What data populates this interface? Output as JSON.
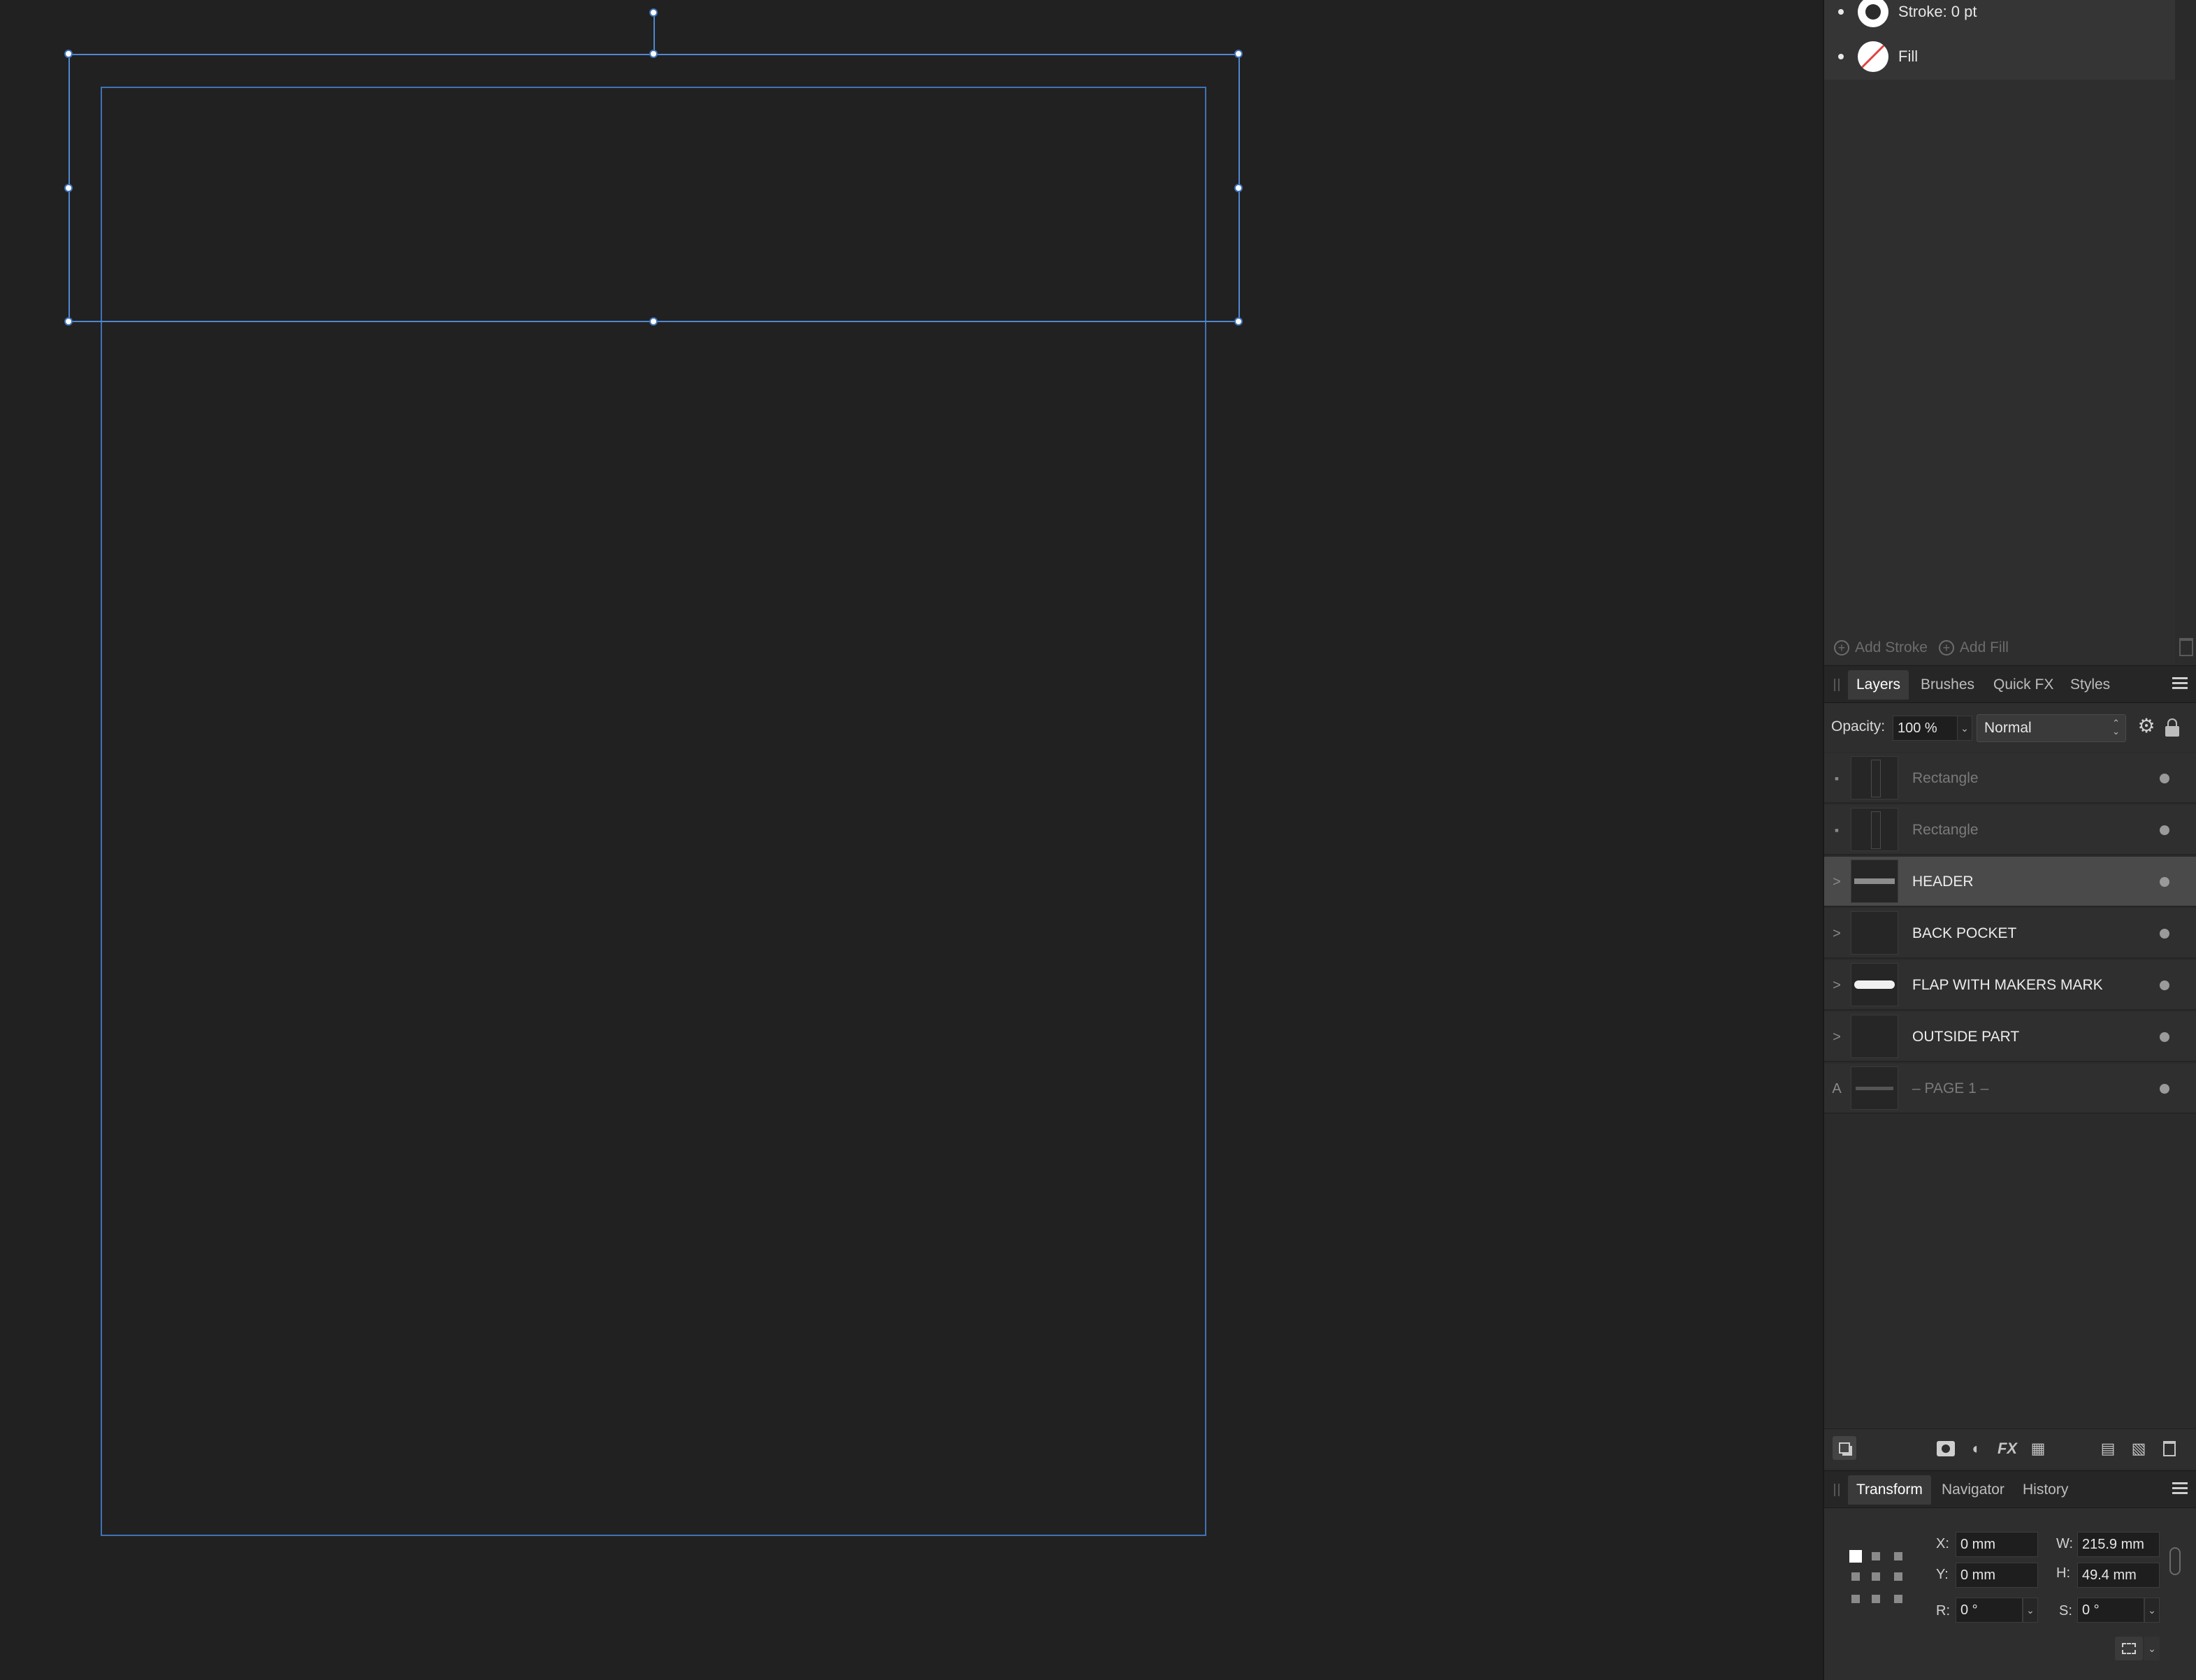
{
  "fx": {
    "stroke_label": "Stroke: 0 pt",
    "fill_label": "Fill",
    "add_stroke": "Add Stroke",
    "add_fill": "Add Fill"
  },
  "layers_panel": {
    "tabs": [
      "Layers",
      "Brushes",
      "Quick FX",
      "Styles"
    ],
    "opacity_label": "Opacity:",
    "opacity_value": "100 %",
    "blend_mode": "Normal",
    "items": [
      {
        "name": "Rectangle",
        "lead": "",
        "dim": true
      },
      {
        "name": "Rectangle",
        "lead": "",
        "dim": true
      },
      {
        "name": "HEADER",
        "lead": ">",
        "dim": false,
        "selected": true
      },
      {
        "name": "BACK POCKET",
        "lead": ">",
        "dim": false
      },
      {
        "name": "FLAP WITH MAKERS MARK",
        "lead": ">",
        "dim": false
      },
      {
        "name": "OUTSIDE PART",
        "lead": ">",
        "dim": false
      },
      {
        "name": "– PAGE 1 –",
        "lead": "A",
        "dim": true
      }
    ]
  },
  "transform_panel": {
    "tabs": [
      "Transform",
      "Navigator",
      "History"
    ],
    "x_label": "X:",
    "x_value": "0 mm",
    "y_label": "Y:",
    "y_value": "0 mm",
    "w_label": "W:",
    "w_value": "215.9 mm",
    "h_label": "H:",
    "h_value": "49.4 mm",
    "r_label": "R:",
    "r_value": "0 °",
    "s_label": "S:",
    "s_value": "0 °"
  },
  "colors": {
    "selection": "#4f87d0",
    "canvas": "#212121",
    "panel": "#2c2c2c"
  }
}
